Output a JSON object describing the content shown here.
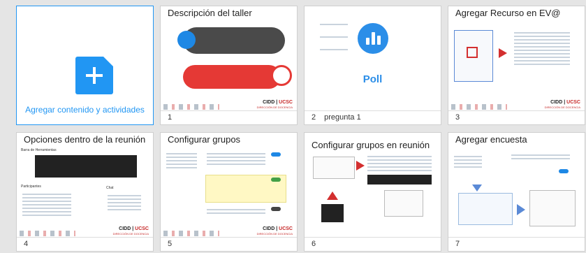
{
  "add_tile": {
    "label": "Agregar contenido y actividades",
    "icon": "add-file-icon"
  },
  "slides": [
    {
      "number": "1",
      "caption_title": "",
      "slide_title": "Descripción del taller",
      "brand": "CIDD",
      "brand_accent": "UCSC",
      "brand_sub": "DIRECCIÓN DE DOCENCIA"
    },
    {
      "number": "2",
      "caption_title": "pregunta 1",
      "slide_title": "",
      "poll_word": "Poll"
    },
    {
      "number": "3",
      "caption_title": "",
      "slide_title": "Agregar Recurso en EV@",
      "brand": "CIDD",
      "brand_accent": "UCSC",
      "brand_sub": "DIRECCIÓN DE DOCENCIA"
    },
    {
      "number": "4",
      "caption_title": "",
      "slide_title": "Opciones dentro de la reunión",
      "sub_a": "Barra de Herramientas",
      "sub_b": "Participantes",
      "sub_c": "Chat",
      "brand": "CIDD",
      "brand_accent": "UCSC",
      "brand_sub": "DIRECCIÓN DE DOCENCIA"
    },
    {
      "number": "5",
      "caption_title": "",
      "slide_title": "Configurar grupos",
      "brand": "CIDD",
      "brand_accent": "UCSC",
      "brand_sub": "DIRECCIÓN DE DOCENCIA"
    },
    {
      "number": "6",
      "caption_title": "",
      "slide_title": "Configurar grupos en reunión"
    },
    {
      "number": "7",
      "caption_title": "",
      "slide_title": "Agregar encuesta"
    }
  ],
  "colors": {
    "accent": "#2196f3",
    "brand_red": "#c62828",
    "poll_blue": "#2b8ee8"
  }
}
